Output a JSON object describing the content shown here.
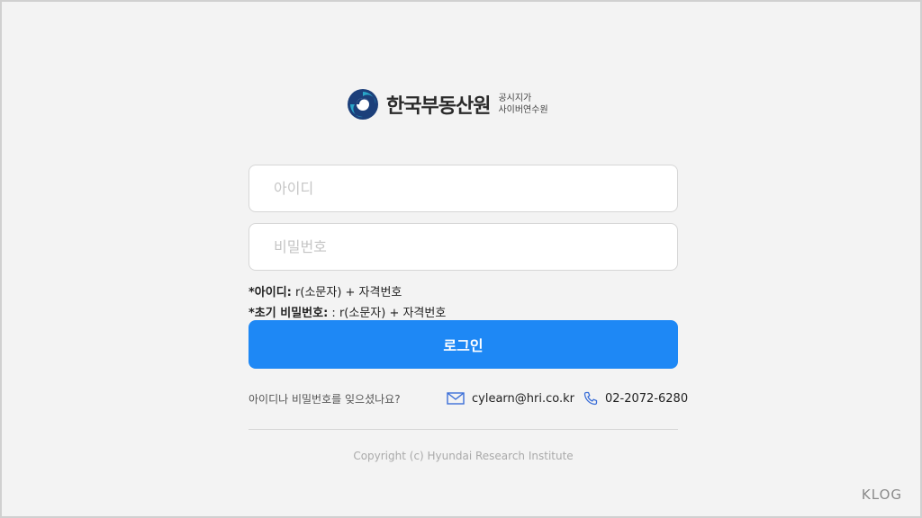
{
  "logo": {
    "name": "한국부동산원",
    "sub_line1": "공시지가",
    "sub_line2": "사이버연수원"
  },
  "form": {
    "id_placeholder": "아이디",
    "password_placeholder": "비밀번호"
  },
  "hints": {
    "id_label": "*아이디:",
    "id_value": " r(소문자) + 자격번호",
    "pw_label": "*초기 비밀번호:",
    "pw_value": " : r(소문자) + 자격번호"
  },
  "login_button": "로그인",
  "forgot_link": "아이디나 비밀번호를 잊으셨나요?",
  "contact": {
    "email": "cylearn@hri.co.kr",
    "phone": "02-2072-6280"
  },
  "copyright": "Copyright (c) Hyundai Research Institute",
  "watermark": "KLOG",
  "colors": {
    "primary": "#1e88f5",
    "logo_navy": "#1c3f7a",
    "logo_teal": "#2aa6c8",
    "background": "#f3f3f3"
  },
  "icons": {
    "email": "envelope-icon",
    "phone": "phone-icon"
  }
}
